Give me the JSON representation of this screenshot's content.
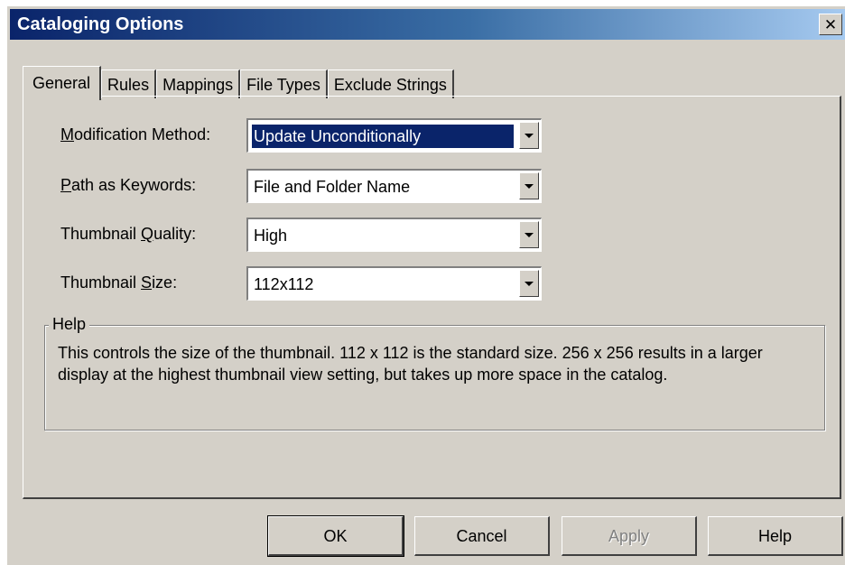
{
  "window": {
    "title": "Cataloging Options",
    "close_glyph": "✕"
  },
  "tabs": [
    {
      "label": "General",
      "active": true
    },
    {
      "label": "Rules"
    },
    {
      "label": "Mappings"
    },
    {
      "label": "File Types"
    },
    {
      "label": "Exclude Strings"
    }
  ],
  "fields": [
    {
      "label_pre": "",
      "label_key": "M",
      "label_post": "odification Method:",
      "value": "Update Unconditionally",
      "selected": true
    },
    {
      "label_pre": "",
      "label_key": "P",
      "label_post": "ath as Keywords:",
      "value": "File and Folder Name"
    },
    {
      "label_pre": "Thumbnail ",
      "label_key": "Q",
      "label_post": "uality:",
      "value": "High"
    },
    {
      "label_pre": "Thumbnail ",
      "label_key": "S",
      "label_post": "ize:",
      "value": "112x112"
    }
  ],
  "help": {
    "title": "Help",
    "text": "This controls the size of the thumbnail. 112 x 112 is the standard size. 256 x 256 results in a larger display at the highest thumbnail view setting, but takes up more space in the catalog."
  },
  "buttons": {
    "ok": "OK",
    "cancel": "Cancel",
    "apply": "Apply",
    "apply_disabled": true,
    "help": "Help"
  },
  "icons": {
    "dropdown_arrow": "chevron-down-icon",
    "close": "close-icon"
  },
  "colors": {
    "title_start": "#0a246a",
    "title_end": "#a6caf0",
    "face": "#d4d0c8",
    "selection": "#0a246a"
  }
}
